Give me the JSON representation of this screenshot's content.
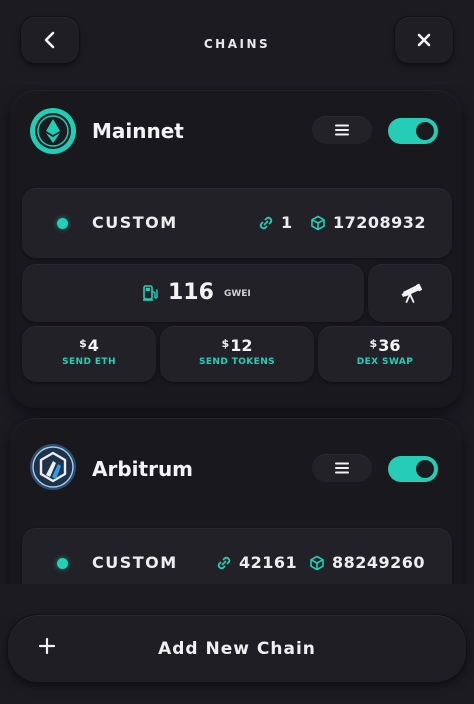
{
  "header": {
    "title": "CHAINS",
    "back_icon": "chevron-left-icon",
    "close_icon": "close-icon"
  },
  "chains": [
    {
      "name": "Mainnet",
      "logo_icon": "ethereum-logo-icon",
      "enabled": true,
      "rpc_label": "CUSTOM",
      "chain_id": "1",
      "block_number": "17208932",
      "gas_price": "116",
      "gas_unit": "GWEI",
      "costs": [
        {
          "currency": "$",
          "amount": "4",
          "label": "SEND ETH"
        },
        {
          "currency": "$",
          "amount": "12",
          "label": "SEND TOKENS"
        },
        {
          "currency": "$",
          "amount": "36",
          "label": "DEX SWAP"
        }
      ]
    },
    {
      "name": "Arbitrum",
      "logo_icon": "arbitrum-logo-icon",
      "enabled": true,
      "rpc_label": "CUSTOM",
      "chain_id": "42161",
      "block_number": "88249260"
    }
  ],
  "footer": {
    "add_label": "Add New Chain",
    "add_icon": "plus-icon"
  },
  "colors": {
    "accent": "#22d0b8",
    "background": "#1c1b21",
    "card": "#19181d",
    "panel": "#222127"
  }
}
